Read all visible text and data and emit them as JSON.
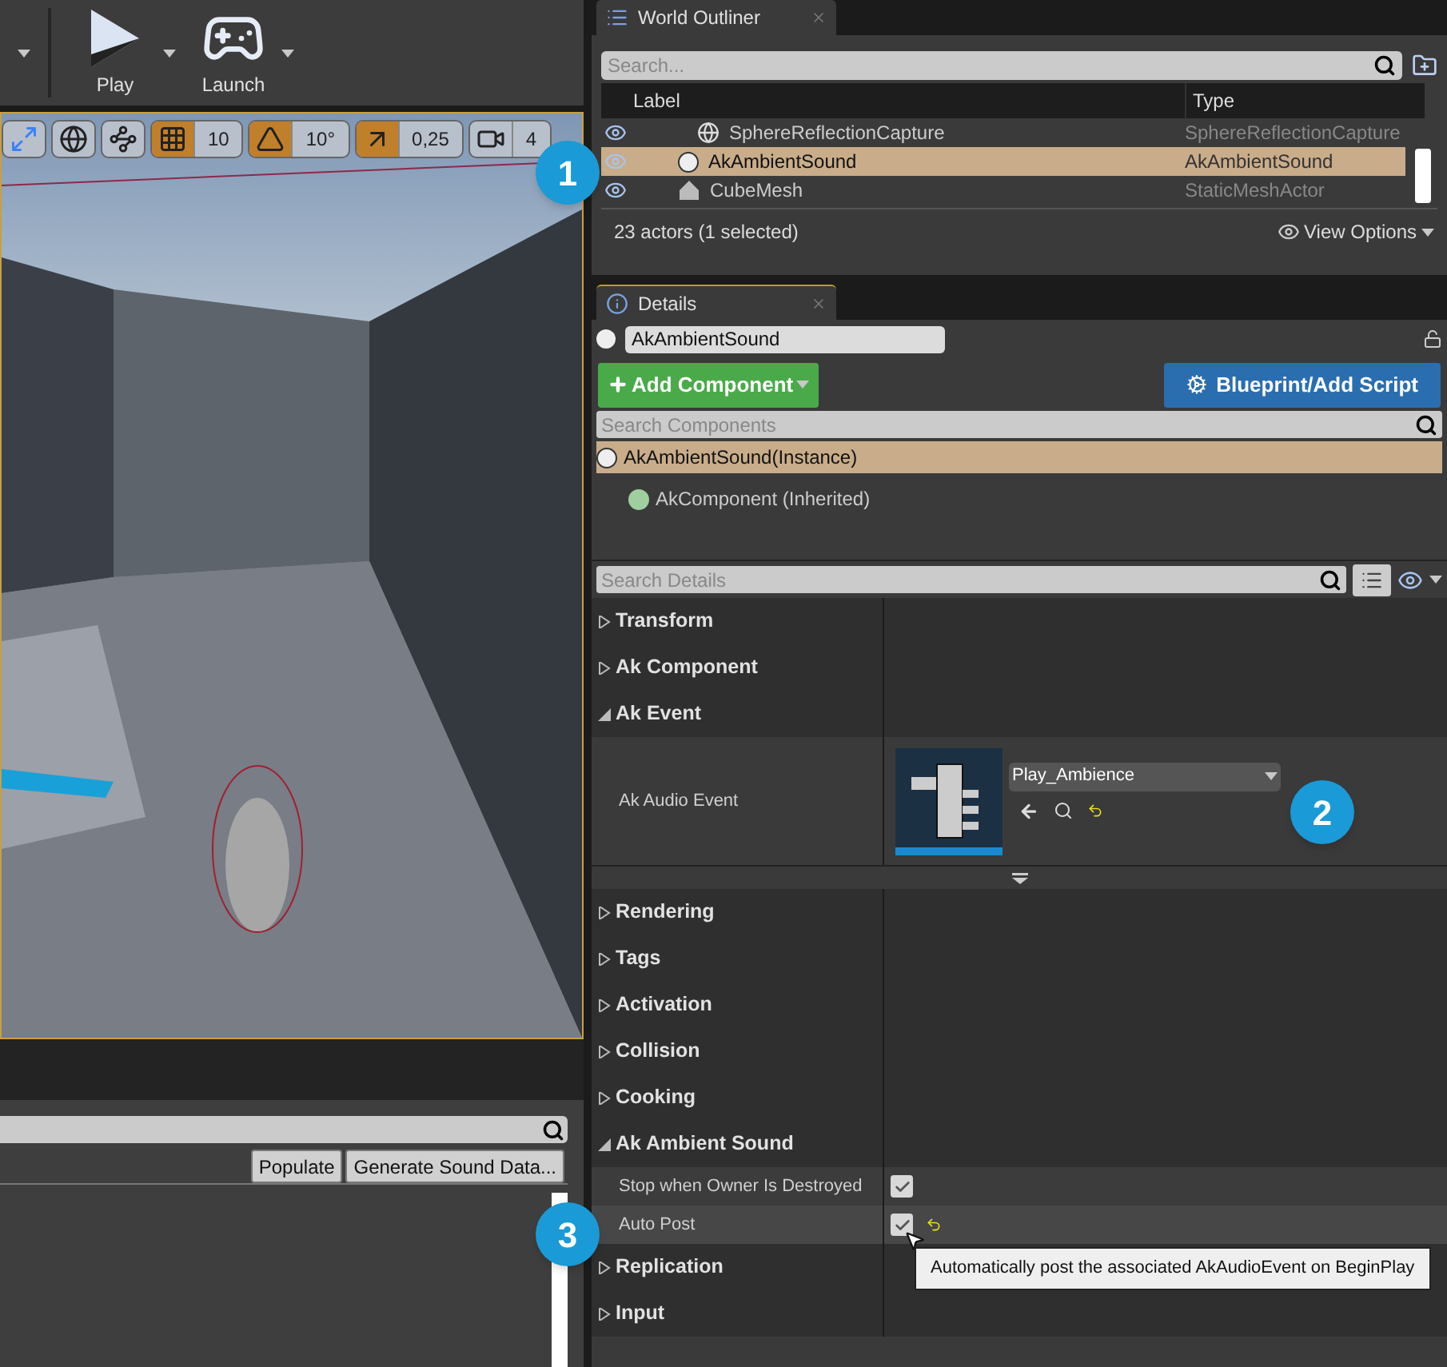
{
  "toolbar": {
    "buttons": [
      {
        "label": "Play",
        "kind": "play"
      },
      {
        "label": "Launch",
        "kind": "launch"
      }
    ]
  },
  "viewport_toolbar": {
    "groups": [
      {
        "kind": "scale",
        "active": false
      },
      {
        "kind": "globe",
        "active": false
      },
      {
        "kind": "surface",
        "active": false
      },
      {
        "kind": "grid",
        "active": true,
        "value": "10"
      },
      {
        "kind": "rotate",
        "active": true,
        "value": "10°"
      },
      {
        "kind": "scale-snap",
        "active": true,
        "value": "0,25"
      },
      {
        "kind": "camera",
        "active": false,
        "value": "4"
      }
    ]
  },
  "sound_panel": {
    "buttons": [
      "Populate",
      "Generate Sound Data..."
    ]
  },
  "world_outliner": {
    "tab": "World Outliner",
    "search_placeholder": "Search...",
    "columns": [
      "Label",
      "Type"
    ],
    "rows": [
      {
        "label": "SphereReflectionCapture",
        "type": "SphereReflectionCapture",
        "selected": false,
        "kind": "capture"
      },
      {
        "label": "AkAmbientSound",
        "type": "AkAmbientSound",
        "selected": true,
        "kind": "sound"
      },
      {
        "label": "CubeMesh",
        "type": "StaticMeshActor",
        "selected": false,
        "kind": "mesh"
      }
    ],
    "footer": "23 actors (1 selected)",
    "view_options": "View Options"
  },
  "details": {
    "tab": "Details",
    "actor_name": "AkAmbientSound",
    "add_component": "Add Component",
    "blueprint": "Blueprint/Add Script",
    "search_components_placeholder": "Search Components",
    "components": [
      {
        "label": "AkAmbientSound(Instance)",
        "selected": true
      },
      {
        "label": "AkComponent (Inherited)",
        "selected": false
      }
    ],
    "search_details_placeholder": "Search Details",
    "categories": [
      {
        "label": "Transform",
        "expanded": false
      },
      {
        "label": "Ak Component",
        "expanded": false
      },
      {
        "label": "Ak Event",
        "expanded": true,
        "properties": [
          {
            "kind": "asset",
            "label": "Ak Audio Event",
            "value": "Play_Ambience",
            "modified": true
          }
        ]
      },
      {
        "label": "Rendering",
        "expanded": false
      },
      {
        "label": "Tags",
        "expanded": false
      },
      {
        "label": "Activation",
        "expanded": false
      },
      {
        "label": "Collision",
        "expanded": false
      },
      {
        "label": "Cooking",
        "expanded": false
      },
      {
        "label": "Ak Ambient Sound",
        "expanded": true,
        "properties": [
          {
            "kind": "checkbox",
            "label": "Stop when Owner Is Destroyed",
            "checked": true,
            "modified": false
          },
          {
            "kind": "checkbox",
            "label": "Auto Post",
            "checked": true,
            "modified": true,
            "tooltip": "Automatically post the associated AkAudioEvent on BeginPlay"
          }
        ]
      },
      {
        "label": "Replication",
        "expanded": false
      },
      {
        "label": "Input",
        "expanded": false
      }
    ]
  },
  "callouts": [
    "1",
    "2",
    "3"
  ]
}
